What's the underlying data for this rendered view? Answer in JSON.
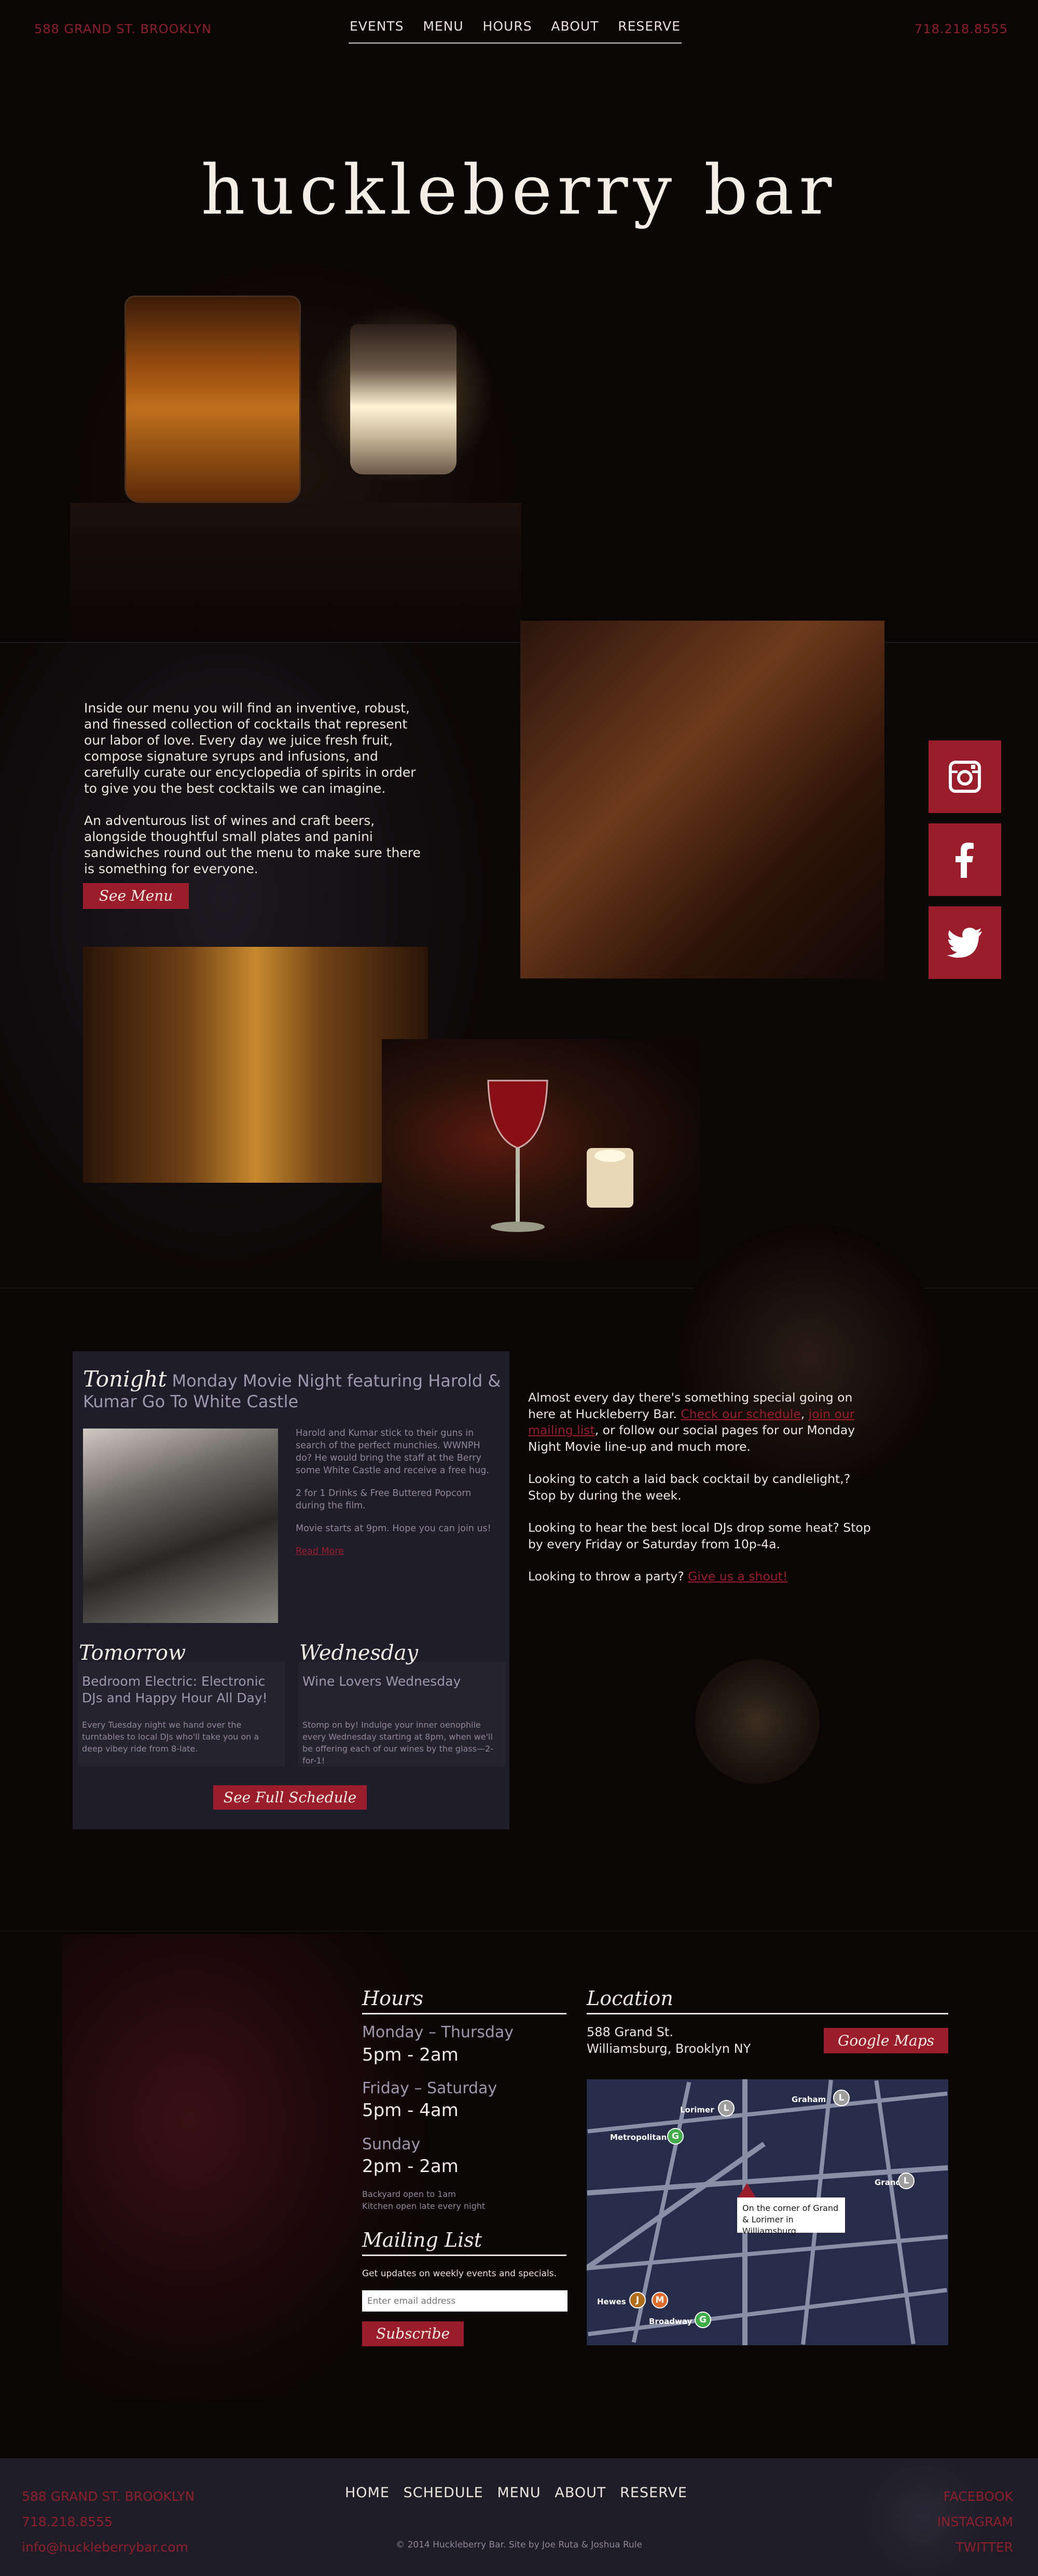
{
  "header": {
    "address": "588 GRAND ST. BROOKLYN",
    "phone": "718.218.8555",
    "nav": [
      "EVENTS",
      "MENU",
      "HOURS",
      "ABOUT",
      "RESERVE"
    ],
    "brand": "huckleberry bar"
  },
  "menu_section": {
    "paragraphs": [
      "Inside our menu you will find an inventive, robust, and finessed collection of cocktails that represent our labor of love. Every day we juice fresh fruit, compose signature syrups and infusions, and carefully curate our encyclopedia of spirits in order to give you the best cocktails we can imagine.",
      "An adventurous list of wines and craft beers, alongside thoughtful small plates and panini sandwiches round out the menu to make sure there is something for everyone."
    ],
    "button": "See Menu"
  },
  "social": [
    "instagram-icon",
    "facebook-icon",
    "twitter-icon"
  ],
  "schedule": {
    "tonight_label": "Tonight",
    "tonight_title": "Monday Movie Night featuring Harold & Kumar Go To White Castle",
    "tonight_body": [
      "Harold and Kumar stick to their guns in search of the perfect munchies. WWNPH do? He would bring the staff at the Berry some White Castle and receive a free hug.",
      "2 for 1 Drinks & Free Buttered Popcorn during the film.",
      "Movie starts at 9pm. Hope you can join us!"
    ],
    "tonight_more": "Read More",
    "tomorrow": {
      "label": "Tomorrow",
      "title": "Bedroom Electric: Electronic DJs and Happy Hour All Day!",
      "desc": "Every Tuesday night we hand over the turntables to local DJs who'll take you on a deep vibey ride from 8-late."
    },
    "wednesday": {
      "label": "Wednesday",
      "title": "Wine Lovers Wednesday",
      "desc": "Stomp on by! Indulge your inner oenophile every Wednesday starting at 8pm, when we'll be offering each of our wines by the glass—2-for-1!"
    },
    "button": "See Full Schedule"
  },
  "events_text": {
    "p1_a": "Almost every day there's something special going on here at Huckleberry Bar. ",
    "p1_link1": "Check our schedule",
    "p1_b": ", ",
    "p1_link2": "join our mailing list",
    "p1_c": ", or follow our social pages for our Monday Night Movie line-up and much more.",
    "p2": "Looking to catch a laid back cocktail by candlelight,? Stop by during the week.",
    "p3": "Looking to hear the best local DJs drop some heat? Stop by every Friday or Saturday from 10p-4a.",
    "p4_a": "Looking to throw a party? ",
    "p4_link": "Give us a shout!"
  },
  "hours": {
    "title": "Hours",
    "rows": [
      {
        "day": "Monday – Thursday",
        "time": "5pm - 2am"
      },
      {
        "day": "Friday – Saturday",
        "time": "5pm - 4am"
      },
      {
        "day": "Sunday",
        "time": "2pm - 2am"
      }
    ],
    "note_1": "Backyard open to 1am",
    "note_2": "Kitchen open late every night"
  },
  "mailing": {
    "title": "Mailing List",
    "desc": "Get updates on weekly events and specials.",
    "placeholder": "Enter email address",
    "button": "Subscribe"
  },
  "location": {
    "title": "Location",
    "address_1": "588 Grand St.",
    "address_2": "Williamsburg, Brooklyn NY",
    "button": "Google Maps",
    "stations": [
      {
        "line": "L",
        "name": "Lorimer"
      },
      {
        "line": "L",
        "name": "Graham"
      },
      {
        "line": "G",
        "name": "Metropolitan"
      },
      {
        "line": "L",
        "name": "Grand"
      },
      {
        "line": "J",
        "name": "Hewes"
      },
      {
        "line": "M",
        "name": ""
      },
      {
        "line": "G",
        "name": "Broadway"
      }
    ],
    "callout": "On the corner of Grand & Lorimer in Williamsburg"
  },
  "footer": {
    "address": "588 GRAND ST. BROOKLYN",
    "phone": "718.218.8555",
    "email": "info@huckleberrybar.com",
    "nav": [
      "HOME",
      "SCHEDULE",
      "MENU",
      "ABOUT",
      "RESERVE"
    ],
    "copyright": "© 2014 Huckleberry Bar. Site by Joe Ruta & Joshua Rule",
    "social": [
      "FACEBOOK",
      "INSTAGRAM",
      "TWITTER"
    ]
  },
  "colors": {
    "accent": "#9b1c2b",
    "background": "#0b0606",
    "panel": "#1f1d29"
  }
}
